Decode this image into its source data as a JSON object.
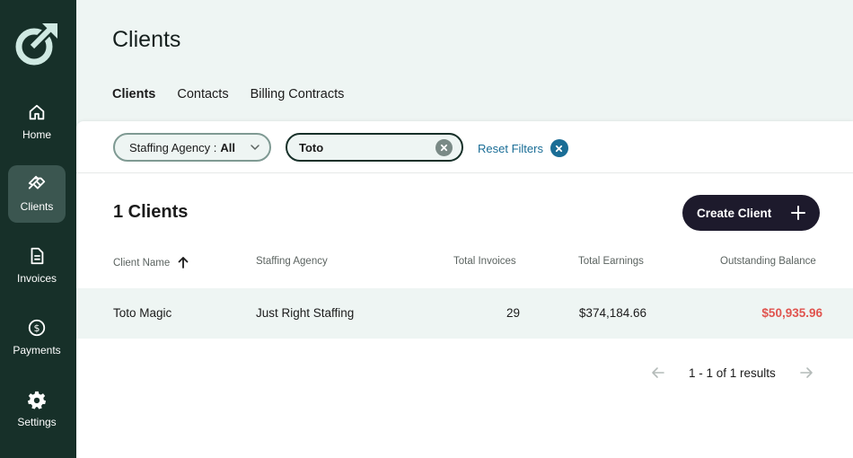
{
  "sidebar": {
    "logo": "brand-logo",
    "items": [
      {
        "label": "Home",
        "icon": "home-icon",
        "active": false
      },
      {
        "label": "Clients",
        "icon": "handshake-icon",
        "active": true
      },
      {
        "label": "Invoices",
        "icon": "document-icon",
        "active": false
      },
      {
        "label": "Payments",
        "icon": "dollar-icon",
        "active": false
      },
      {
        "label": "Settings",
        "icon": "gear-icon",
        "active": false
      }
    ]
  },
  "header": {
    "title": "Clients",
    "tabs": [
      {
        "label": "Clients",
        "active": true
      },
      {
        "label": "Contacts",
        "active": false
      },
      {
        "label": "Billing Contracts",
        "active": false
      }
    ]
  },
  "filters": {
    "agency_label": "Staffing Agency :",
    "agency_value": "All",
    "search_value": "Toto",
    "reset_label": "Reset Filters"
  },
  "summary": {
    "count_label": "1 Clients",
    "create_label": "Create Client"
  },
  "table": {
    "columns": [
      "Client Name",
      "Staffing Agency",
      "Total Invoices",
      "Total Earnings",
      "Outstanding Balance"
    ],
    "rows": [
      [
        "Toto Magic",
        "Just Right Staffing",
        "29",
        "$374,184.66",
        "$50,935.96"
      ]
    ]
  },
  "pagination": {
    "text": "1 - 1 of 1 results"
  },
  "colors": {
    "sidebar": "#173029",
    "active_nav": "#3b5650",
    "accent_link": "#1a6d96",
    "negative": "#e0544f",
    "primary_button": "#1d1a2c"
  }
}
